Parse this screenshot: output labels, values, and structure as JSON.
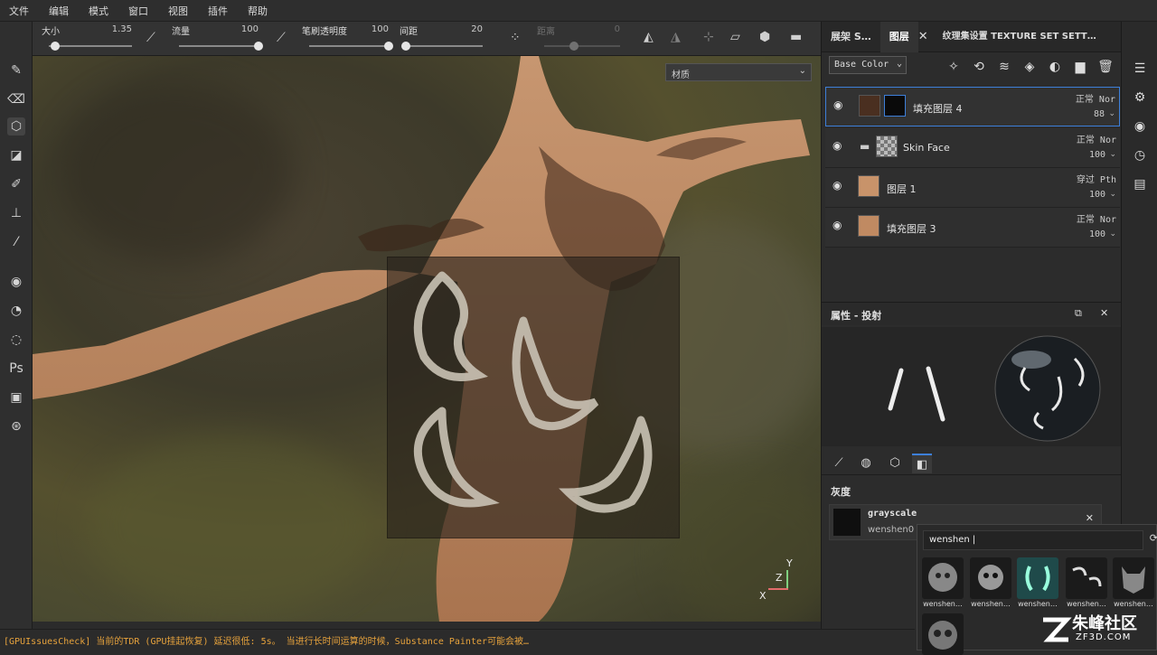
{
  "menu": [
    "文件",
    "编辑",
    "模式",
    "窗口",
    "视图",
    "插件",
    "帮助"
  ],
  "toolbar": {
    "size_label": "大小",
    "size_value": "1.35",
    "flow_label": "流量",
    "flow_value": "100",
    "opacity_label": "笔刷透明度",
    "opacity_value": "100",
    "spacing_label": "间距",
    "spacing_value": "20",
    "distance_label": "距离",
    "distance_value": "0"
  },
  "viewport": {
    "material_select": "材质",
    "axis_x": "X",
    "axis_y": "Y",
    "axis_z": "Z"
  },
  "status": "[GPUIssuesCheck] 当前的TDR (GPU挂起恢复) 延迟很低: 5s。 当进行长时间运算的时候，Substance Painter可能会被…",
  "right_tabs": [
    "展架 S…",
    "图层",
    "纹理集设置 TEXTURE SET SETT…"
  ],
  "channel": "Base Color",
  "layers": [
    {
      "name": "填充图层 4",
      "blend": "正常 Nor",
      "opacity": "88"
    },
    {
      "name": "Skin Face",
      "blend": "正常 Nor",
      "opacity": "100"
    },
    {
      "name": "图层 1",
      "blend": "穿过 Pth",
      "opacity": "100"
    },
    {
      "name": "填充图层 3",
      "blend": "正常 Nor",
      "opacity": "100"
    }
  ],
  "props": {
    "title": "属性 - 投射",
    "gray_label": "灰度",
    "slot_title": "grayscale",
    "slot_sub": "wenshen0"
  },
  "popup": {
    "search": "wenshen |",
    "results": [
      "wenshen…",
      "wenshen…",
      "wenshen…",
      "wenshen…",
      "wenshen…",
      ""
    ]
  },
  "watermark": {
    "brand": "朱峰社区",
    "site": "ZF3D.COM"
  },
  "colors": {
    "accent": "#3d7fd9",
    "status": "#e6a23c",
    "skin": "#c8936a"
  }
}
